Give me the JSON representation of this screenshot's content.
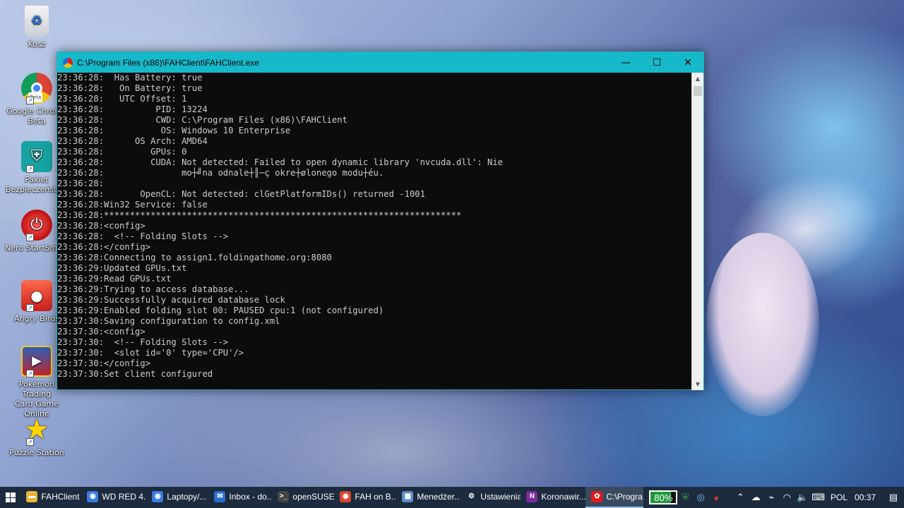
{
  "desktop": {
    "icons": [
      {
        "label": "Kosz",
        "icon": "recycle-bin-icon"
      },
      {
        "label": "Google Chrome\nBeta",
        "icon": "chrome-beta-icon",
        "badge": "Beta"
      },
      {
        "label": "Pakiet\nBezpieczeństwa",
        "icon": "security-shield-icon"
      },
      {
        "label": "Nero StartSmart",
        "icon": "nero-power-icon"
      },
      {
        "label": "Angry Birds",
        "icon": "angry-bird-icon"
      },
      {
        "label": "Pokémon Trading\nCard Game Online",
        "icon": "pokemon-tcg-icon"
      },
      {
        "label": "Puzzle Station",
        "icon": "star-icon"
      }
    ]
  },
  "window": {
    "title": "C:\\Program Files (x86)\\FAHClient\\FAHClient.exe",
    "minimize": "—",
    "maximize": "☐",
    "close": "✕",
    "lines": [
      "23:36:28:  Has Battery: true",
      "23:36:28:   On Battery: true",
      "23:36:28:   UTC Offset: 1",
      "23:36:28:          PID: 13224",
      "23:36:28:          CWD: C:\\Program Files (x86)\\FAHClient",
      "23:36:28:           OS: Windows 10 Enterprise",
      "23:36:28:      OS Arch: AMD64",
      "23:36:28:         GPUs: 0",
      "23:36:28:         CUDA: Not detected: Failed to open dynamic library 'nvcuda.dll': Nie",
      "23:36:28:               mo┼╝na odnale┼║─ç okre┼ølonego modu┼éu.",
      "23:36:28:",
      "23:36:28:       OpenCL: Not detected: clGetPlatformIDs() returned -1001",
      "23:36:28:Win32 Service: false",
      "23:36:28:*********************************************************************",
      "23:36:28:<config>",
      "23:36:28:  <!-- Folding Slots -->",
      "23:36:28:</config>",
      "23:36:28:Connecting to assign1.foldingathome.org:8080",
      "23:36:29:Updated GPUs.txt",
      "23:36:29:Read GPUs.txt",
      "23:36:29:Trying to access database...",
      "23:36:29:Successfully acquired database lock",
      "23:36:29:Enabled folding slot 00: PAUSED cpu:1 (not configured)",
      "23:37:30:Saving configuration to config.xml",
      "23:37:30:<config>",
      "23:37:30:  <!-- Folding Slots -->",
      "23:37:30:  <slot id='0' type='CPU'/>",
      "23:37:30:</config>",
      "23:37:30:Set client configured"
    ]
  },
  "taskbar": {
    "items": [
      {
        "label": "FAHClient",
        "icon": "folder-icon",
        "color": "#e8b43a",
        "active": false
      },
      {
        "label": "WD RED 4...",
        "icon": "chrome-icon",
        "color": "#3b7be0",
        "active": false
      },
      {
        "label": "Laptopy/...",
        "icon": "chrome-icon",
        "color": "#3b7be0",
        "active": false
      },
      {
        "label": "Inbox - do...",
        "icon": "mail-icon",
        "color": "#2a6fd0",
        "active": false
      },
      {
        "label": "openSUSE...",
        "icon": "terminal-icon",
        "color": "#444444",
        "active": false
      },
      {
        "label": "FAH on B...",
        "icon": "chrome-icon",
        "color": "#d9462f",
        "active": false
      },
      {
        "label": "Menedżer...",
        "icon": "task-manager-icon",
        "color": "#5a8fc9",
        "active": false
      },
      {
        "label": "Ustawienia",
        "icon": "gear-icon",
        "color": "transparent",
        "active": false
      },
      {
        "label": "Koronawir...",
        "icon": "onenote-icon",
        "color": "#7a2a9c",
        "active": false
      },
      {
        "label": "C:\\Progra...",
        "icon": "fah-icon",
        "color": "#e21b1b",
        "active": true
      }
    ],
    "battery": "80%",
    "language": "POL",
    "time": "00:37"
  }
}
